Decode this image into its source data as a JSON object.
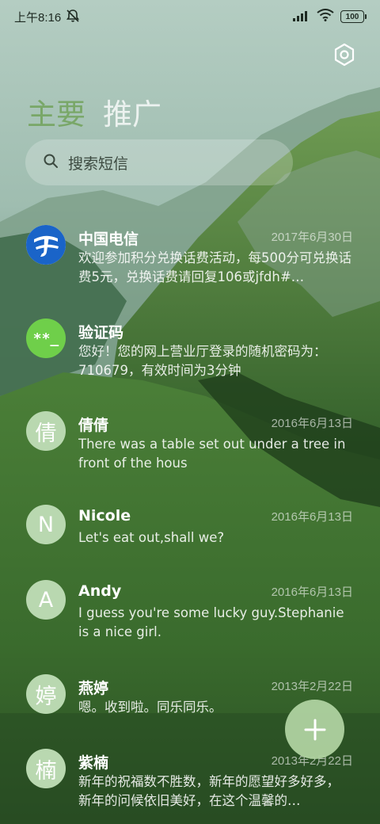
{
  "status_bar": {
    "time": "上午8:16",
    "battery": "100"
  },
  "tabs": {
    "main": "主要",
    "promotions": "推广"
  },
  "search": {
    "placeholder": "搜索短信"
  },
  "messages": [
    {
      "avatar_text": "",
      "avatar_icon": "china-telecom-logo",
      "sender": "中国电信",
      "date": "2017年6月30日",
      "preview": "欢迎参加积分兑换话费活动，每500分可兑换话费5元，兑换话费请回复106或jfdh#…"
    },
    {
      "avatar_text": "**_",
      "sender": "验证码",
      "date": "",
      "preview": "您好！您的网上营业厅登录的随机密码为：710679，有效时间为3分钟"
    },
    {
      "avatar_text": "倩",
      "sender": "倩倩",
      "date": "2016年6月13日",
      "preview": "There was a table set out under a tree in front of the hous"
    },
    {
      "avatar_text": "N",
      "sender": "Nicole",
      "date": "2016年6月13日",
      "preview": "Let's eat out,shall we?"
    },
    {
      "avatar_text": "A",
      "sender": "Andy",
      "date": "2016年6月13日",
      "preview": "I guess you're some lucky guy.Stephanie is a nice girl."
    },
    {
      "avatar_text": "婷",
      "sender": "燕婷",
      "date": "2013年2月22日",
      "preview": "嗯。收到啦。同乐同乐。"
    },
    {
      "avatar_text": "楠",
      "sender": "紫楠",
      "date": "2013年2月22日",
      "preview": "新年的祝福数不胜数，新年的愿望好多好多，新年的问候依旧美好，在这个温馨的…"
    }
  ],
  "colors": {
    "accent": "#79a768",
    "avatar": "#b9d8b0",
    "verify_avatar": "#6fcf4a",
    "telecom_blue": "#1a64c8"
  }
}
